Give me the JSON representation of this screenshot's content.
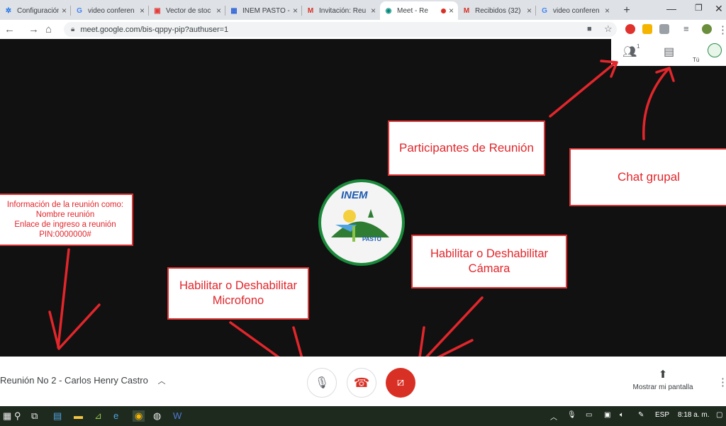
{
  "tabs": [
    {
      "label": "Configuración",
      "icon": "gear-icon",
      "fav": "✲",
      "favcolor": "#1a73e8"
    },
    {
      "label": "video conferen",
      "icon": "google-icon",
      "fav": "G",
      "favcolor": "#4285f4"
    },
    {
      "label": "Vector de stoc",
      "icon": "vector-site-icon",
      "fav": "▣",
      "favcolor": "#e53935"
    },
    {
      "label": "INEM PASTO -",
      "icon": "inem-site-icon",
      "fav": "▦",
      "favcolor": "#3367d6"
    },
    {
      "label": "Invitación: Reu",
      "icon": "gmail-icon",
      "fav": "M",
      "favcolor": "#d93025"
    },
    {
      "label": "Meet - Re",
      "icon": "meet-icon",
      "fav": "◉",
      "favcolor": "#00897b",
      "active": true
    },
    {
      "label": "Recibidos (32)",
      "icon": "gmail-icon",
      "fav": "M",
      "favcolor": "#d93025"
    },
    {
      "label": "video conferen",
      "icon": "google-icon",
      "fav": "G",
      "favcolor": "#4285f4"
    }
  ],
  "newtab": "+",
  "address": {
    "url": "meet.google.com/bis-qppy-pip?authuser=1"
  },
  "topbar": {
    "participants_count": "1",
    "self_label": "Tú"
  },
  "notes": {
    "info": [
      "Información de la reunión como:",
      "Nombre reunión",
      "Enlace de ingreso a reunión",
      "PIN:0000000#"
    ],
    "participants": "Participantes de Reunión",
    "chat": "Chat grupal",
    "mic": "Habilitar o Deshabilitar Microfono",
    "camera": "Habilitar o Deshabilitar Cámara"
  },
  "logo": {
    "top_text": "INEM",
    "bottom_text": "PASTO"
  },
  "bottombar": {
    "meeting_name": "Reunión No 2 - Carlos Henry Castro",
    "present_label": "Mostrar mi pantalla"
  },
  "taskbar": {
    "lang": "ESP",
    "time": "8:18 a. m."
  },
  "colors": {
    "annotation": "#e2262b",
    "hangup": "#d93025",
    "camera_off": "#d93025"
  }
}
